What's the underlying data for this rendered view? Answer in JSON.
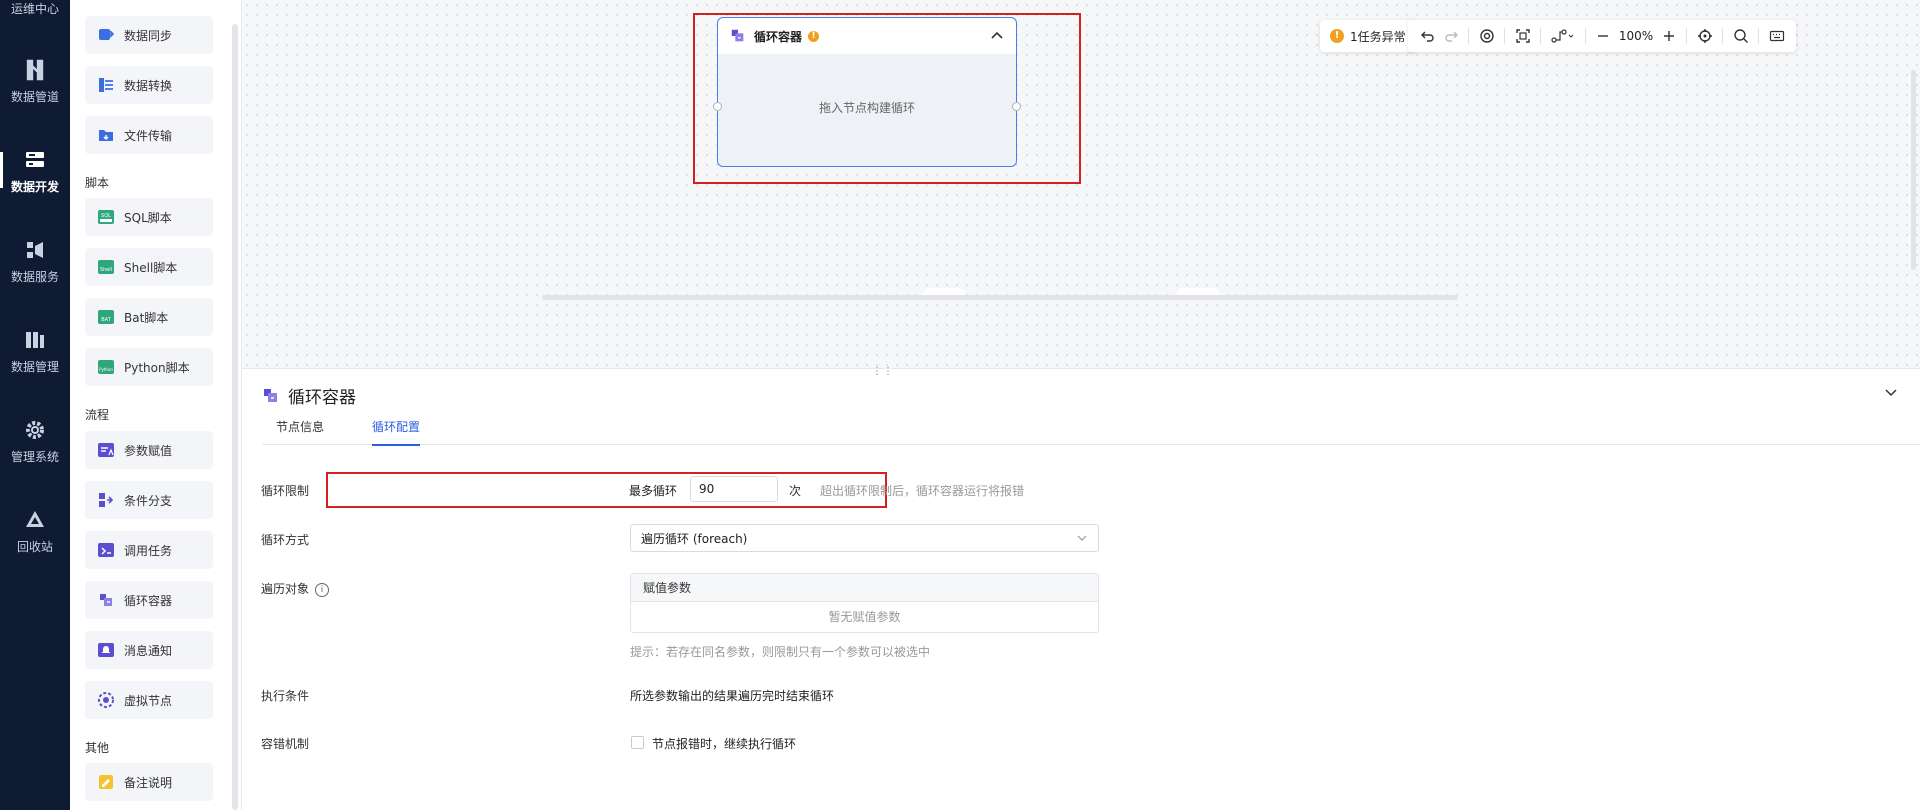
{
  "nav": {
    "top_label": "运维中心",
    "items": [
      {
        "label": "数据管道",
        "icon": "pipeline-icon"
      },
      {
        "label": "数据开发",
        "icon": "dev-icon",
        "active": true
      },
      {
        "label": "数据服务",
        "icon": "service-icon"
      },
      {
        "label": "数据管理",
        "icon": "manage-icon"
      },
      {
        "label": "管理系统",
        "icon": "gear-icon"
      },
      {
        "label": "回收站",
        "icon": "recycle-icon"
      }
    ]
  },
  "palette": {
    "items_top": [
      {
        "label": "数据同步",
        "icon": "data-sync-icon"
      },
      {
        "label": "数据转换",
        "icon": "data-transform-icon"
      },
      {
        "label": "文件传输",
        "icon": "file-transfer-icon"
      }
    ],
    "script_group": "脚本",
    "script_items": [
      {
        "label": "SQL脚本",
        "icon": "sql-script-icon",
        "badge": "SQL"
      },
      {
        "label": "Shell脚本",
        "icon": "shell-script-icon",
        "badge": "Shell"
      },
      {
        "label": "Bat脚本",
        "icon": "bat-script-icon",
        "badge": "BAT"
      },
      {
        "label": "Python脚本",
        "icon": "python-script-icon",
        "badge": "Python"
      }
    ],
    "flow_group": "流程",
    "flow_items": [
      {
        "label": "参数赋值",
        "icon": "param-assign-icon"
      },
      {
        "label": "条件分支",
        "icon": "branch-icon"
      },
      {
        "label": "调用任务",
        "icon": "call-task-icon"
      },
      {
        "label": "循环容器",
        "icon": "loop-container-icon"
      },
      {
        "label": "消息通知",
        "icon": "notification-icon"
      },
      {
        "label": "虚拟节点",
        "icon": "virtual-node-icon"
      }
    ],
    "other_group": "其他",
    "other_items": [
      {
        "label": "备注说明",
        "icon": "note-icon"
      }
    ]
  },
  "canvas": {
    "node": {
      "title": "循环容器",
      "warning": "!",
      "placeholder": "拖入节点构建循环"
    },
    "task_alert": {
      "icon": "!",
      "text": "1任务异常"
    },
    "zoom": "100%"
  },
  "detail": {
    "title": "循环容器",
    "tabs": [
      {
        "label": "节点信息",
        "active": false
      },
      {
        "label": "循环配置",
        "active": true
      }
    ],
    "loop_limit": {
      "label": "循环限制",
      "prefix": "最多循环",
      "value": "90",
      "unit": "次",
      "hint": "超出循环限制后，循环容器运行将报错"
    },
    "loop_mode": {
      "label": "循环方式",
      "value": "遍历循环 (foreach)"
    },
    "iterate_target": {
      "label": "遍历对象",
      "info": "i",
      "table_header": "赋值参数",
      "empty_text": "暂无赋值参数",
      "tip": "提示：若存在同名参数，则限制只有一个参数可以被选中"
    },
    "exec_condition": {
      "label": "执行条件",
      "text": "所选参数输出的结果遍历完时结束循环"
    },
    "fault_tolerance": {
      "label": "容错机制",
      "checked": false,
      "checkbox_label": "节点报错时，继续执行循环"
    }
  },
  "colors": {
    "nav_bg": "#0f1a33",
    "accent": "#2b5fe0",
    "warning": "#f0a020",
    "highlight_red": "#d32020"
  }
}
